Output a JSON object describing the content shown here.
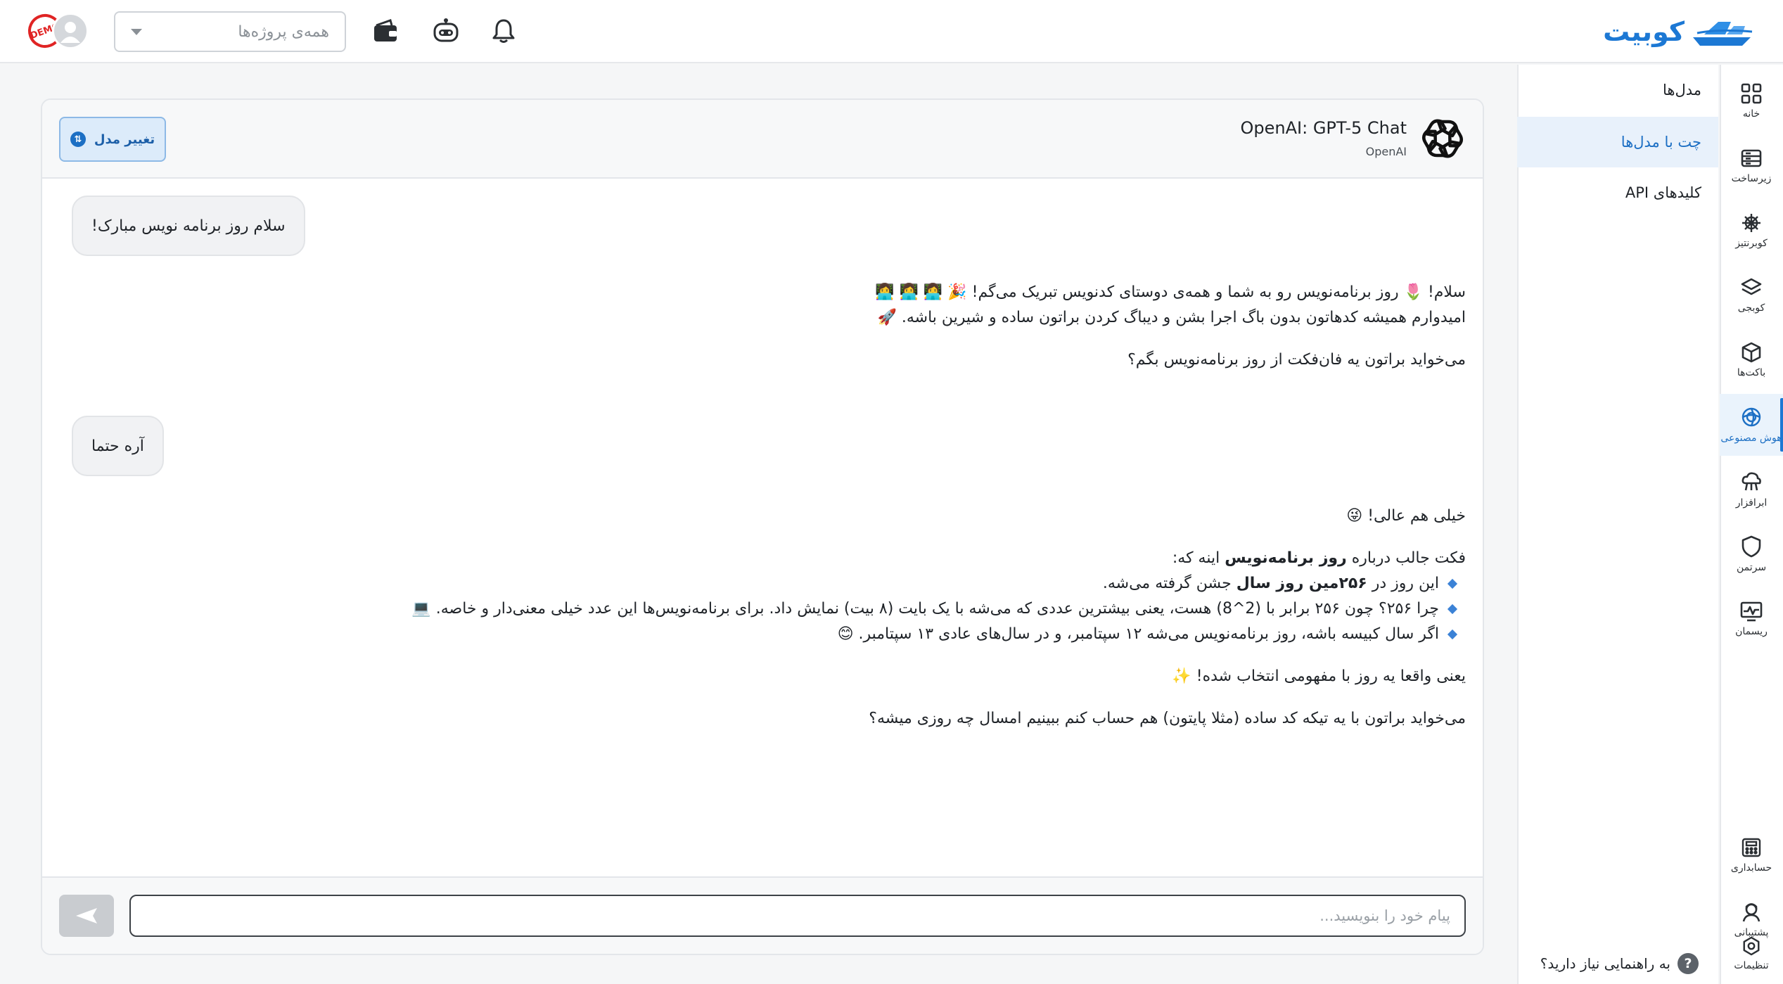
{
  "brand": {
    "name": "کوبیت",
    "color": "#1c78d4"
  },
  "topbar": {
    "project_select": {
      "placeholder": "همه‌ی پروژه‌ها"
    },
    "demo_badge": "DEMO",
    "icons": [
      "wallet-icon",
      "robot-icon",
      "bell-icon"
    ]
  },
  "rail": {
    "items": [
      {
        "label": "خانه",
        "icon": "grid-icon"
      },
      {
        "label": "زیرساخت",
        "icon": "server-icon"
      },
      {
        "label": "کوبرنتیز",
        "icon": "helm-icon"
      },
      {
        "label": "کوبجی",
        "icon": "layers-icon"
      },
      {
        "label": "باکت‌ها",
        "icon": "box-icon"
      },
      {
        "label": "هوش مصنوعی",
        "icon": "ai-icon",
        "active": true
      },
      {
        "label": "ابرافزار",
        "icon": "cloud-app-icon"
      },
      {
        "label": "سرتمن",
        "icon": "shield-icon"
      },
      {
        "label": "ریسمان",
        "icon": "monitor-icon"
      },
      {
        "label": "حسابداری",
        "icon": "calculator-icon"
      },
      {
        "label": "پشتیبانی",
        "icon": "support-icon"
      },
      {
        "label": "تنظیمات",
        "icon": "settings-icon"
      }
    ]
  },
  "subnav": {
    "items": [
      {
        "label": "مدل‌ها"
      },
      {
        "label": "چت با مدل‌ها",
        "active": true
      },
      {
        "label": "کلیدهای API"
      }
    ],
    "help": "به راهنمایی نیاز دارید؟"
  },
  "chat": {
    "model_title": "OpenAI: GPT-5 Chat",
    "model_provider": "OpenAI",
    "change_model_label": "تغییر مدل",
    "messages": {
      "user1": "سلام روز برنامه نویس مبارک!",
      "a1_line1": "سلام! 🌷 روز برنامه‌نویس رو به شما و همه‌ی دوستای کدنویس تبریک می‌گم! 🎉 👩‍💻 👩‍💻 👩‍💻",
      "a1_line2": "امیدوارم همیشه کدهاتون بدون باگ اجرا بشن و دیباگ کردن براتون ساده و شیرین باشه. 🚀",
      "a1_line3": "می‌خواید براتون یه فان‌فکت از روز برنامه‌نویس بگم؟",
      "user2": "آره حتما",
      "a2_line1": "خیلی هم عالی! 😜",
      "a2_intro_pre": "فکت جالب درباره ",
      "a2_intro_bold": "روز برنامه‌نویس",
      "a2_intro_post": " اینه که:",
      "b1_pre": "این روز در ",
      "b1_bold": "۲۵۶مین روز سال",
      "b1_post": " جشن گرفته می‌شه.",
      "b2": "چرا ۲۵۶؟ چون ۲۵۶ برابر با (2^8) هست، یعنی بیشترین عددی که می‌شه با یک بایت (۸ بیت) نمایش داد. برای برنامه‌نویس‌ها این عدد خیلی معنی‌دار و خاصه. 💻",
      "b3": "اگر سال کبیسه باشه، روز برنامه‌نویس می‌شه ۱۲ سپتامبر، و در سال‌های عادی ۱۳ سپتامبر. 😊",
      "a2_line3": "یعنی واقعا یه روز با مفهومی انتخاب شده! ✨",
      "a2_line4": "می‌خواید براتون با یه تیکه کد ساده (مثلا پایتون) هم حساب کنم ببینیم امسال چه روزی میشه؟"
    },
    "input_placeholder": "پیام خود را بنویسید..."
  }
}
